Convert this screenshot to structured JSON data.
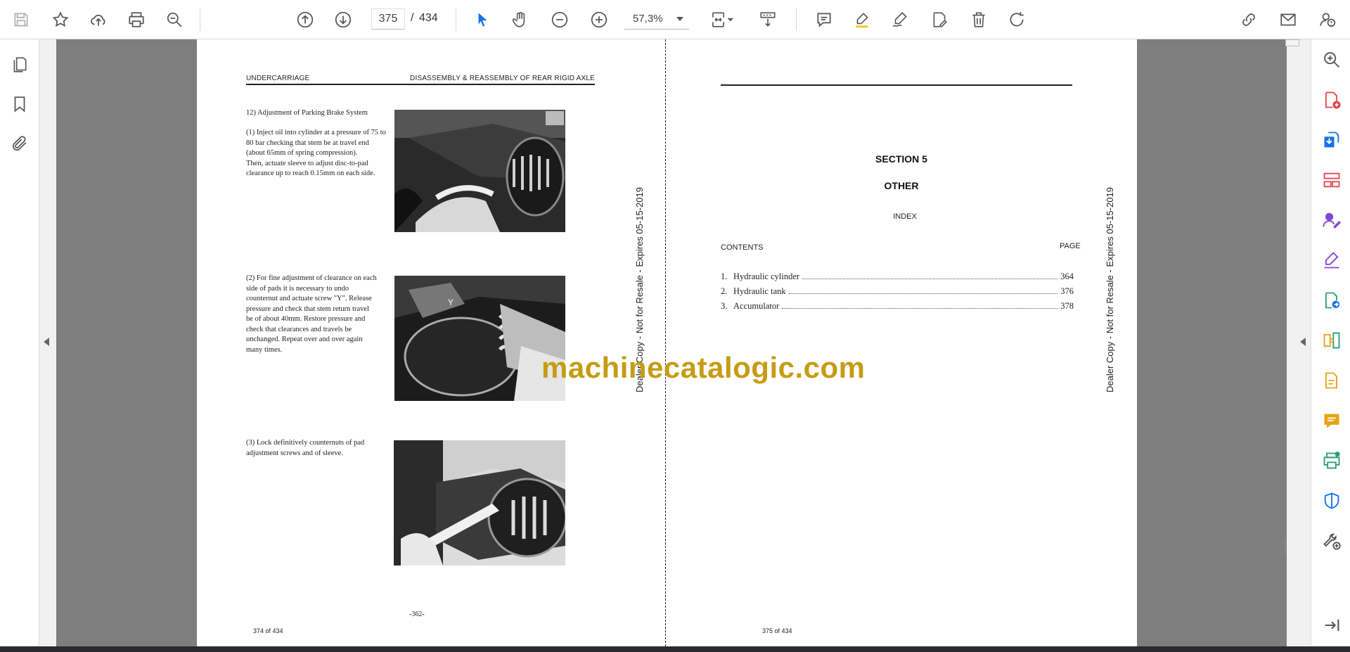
{
  "toolbar": {
    "current_page": "375",
    "page_separator": "/",
    "total_pages": "434",
    "zoom": "57,3%"
  },
  "left_page": {
    "header_left": "UNDERCARRIAGE",
    "header_right": "DISASSEMBLY  &  REASSEMBLY   OF REAR RIGID AXLE",
    "heading": "12) Adjustment of Parking Brake System",
    "step1": "(1) Inject oil into cylinder at a pressure of 75 to\n      80 bar checking that stem be at travel end\n      (about 65mm of spring compression).\n      Then, actuate sleeve to adjust disc-to-pad\n      clearance up to reach 0.15mm on each side.",
    "step2": "(2) For fine adjustment of clearance on each\n      side of pads it is necessary to undo\n      counternut and actuate screw \"Y\". Release\n      pressure and check that stem return travel\n      be of about 40mm. Restore pressure and\n      check that clearances and travels be\n      unchanged. Repeat over and over again\n      many times.",
    "step3": "(3) Lock definitively counternuts of pad\n      adjustment screws and of sleeve.",
    "photo_label_y": "Y",
    "page_number": "-362-",
    "footer": "374 of 434",
    "dealer_notice": "Dealer Copy - Not for Resale - Expires 05-15-2019"
  },
  "right_page": {
    "section": "SECTION 5",
    "title": "OTHER",
    "index": "INDEX",
    "contents_label": "CONTENTS",
    "page_label": "PAGE",
    "toc": [
      {
        "num": "1.",
        "title": "Hydraulic cylinder",
        "page": "364"
      },
      {
        "num": "2.",
        "title": "Hydraulic tank",
        "page": "376"
      },
      {
        "num": "3.",
        "title": "Accumulator",
        "page": "378"
      }
    ],
    "footer": "375 of 434",
    "dealer_notice": "Dealer Copy - Not for Resale - Expires 05-15-2019"
  },
  "watermark": "machinecatalogic.com",
  "icons": {
    "toolbar": [
      "save-icon",
      "bookmark-star-icon",
      "upload-cloud-icon",
      "print-icon",
      "zoom-search-icon",
      "prev-page-icon",
      "next-page-icon",
      "select-cursor-icon",
      "hand-pan-icon",
      "zoom-out-icon",
      "zoom-in-icon",
      "fit-page-icon",
      "scroll-mode-icon",
      "comment-icon",
      "highlight-icon",
      "sign-pen-icon",
      "edit-text-icon",
      "delete-icon",
      "rotate-icon",
      "share-link-icon",
      "email-icon",
      "account-help-icon"
    ],
    "left_nav": [
      "pages-icon",
      "bookmarks-icon",
      "attachments-icon"
    ],
    "right_rail": [
      "zoom-tool-icon",
      "create-pdf-icon",
      "export-pdf-icon",
      "organize-pages-icon",
      "request-signature-icon",
      "fill-sign-icon",
      "send-review-icon",
      "compare-files-icon",
      "edit-pdf-icon",
      "comment-tool-icon",
      "print-production-icon",
      "protect-icon",
      "more-tools-icon",
      "expand-panel-icon"
    ]
  },
  "colors": {
    "accent_blue": "#1473e6",
    "watermark_gold": "#c69c14",
    "gutter_gray": "#7e7e7e",
    "rail_red": "#e34850",
    "rail_purple": "#8248d4",
    "rail_green": "#2d9d78",
    "rail_yellow": "#e8a215"
  }
}
